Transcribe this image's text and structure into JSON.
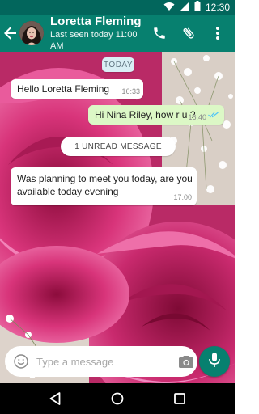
{
  "status_bar": {
    "time": "12:30",
    "icons": [
      "wifi-icon",
      "signal-icon",
      "battery-icon"
    ]
  },
  "header": {
    "contact_name": "Loretta Fleming",
    "last_seen": "Last seen today 11:00 AM",
    "actions": [
      "phone-icon",
      "attach-icon",
      "more-icon"
    ],
    "color": "#07806f"
  },
  "chat": {
    "date_chip": "TODAY",
    "messages": [
      {
        "direction": "in",
        "text": "Hello Loretta Fleming",
        "time": "16:33"
      },
      {
        "direction": "out",
        "text": "Hi Nina Riley, how r u ?",
        "time": "16:40",
        "status": "read"
      },
      {
        "direction": "in",
        "text": "Was planning to meet you today, are you available today evening",
        "time": "17:00"
      }
    ],
    "unread_label": "1 UNREAD MESSAGE"
  },
  "composer": {
    "placeholder": "Type a message",
    "icons": [
      "emoji-icon",
      "camera-icon",
      "mic-icon"
    ]
  },
  "nav": [
    "back-triangle-icon",
    "home-circle-icon",
    "recents-square-icon"
  ],
  "colors": {
    "status_bar": "#02665c",
    "accent": "#07806f",
    "outgoing_bubble": "#dcf8c6",
    "read_ticks": "#4fc3f7"
  }
}
